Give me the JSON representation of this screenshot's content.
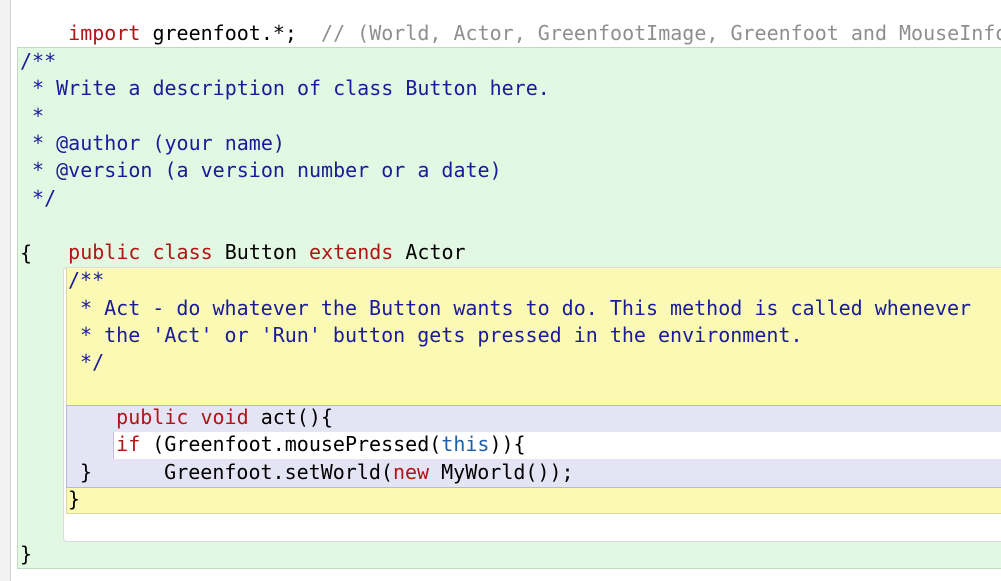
{
  "editor": {
    "import_line": {
      "keyword": "import",
      "statement": " greenfoot.*;",
      "comment": "  // (World, Actor, GreenfootImage, Greenfoot and MouseInfo)"
    },
    "class_doc": {
      "open": "/**",
      "line1": " * Write a description of class Button here.",
      "line2": " *",
      "line3": " * @author (your name)",
      "line4": " * @version (a version number or a date)",
      "close": " */"
    },
    "class_decl": {
      "kw_public": "public",
      "kw_class": "class",
      "name": "Button",
      "kw_extends": "extends",
      "parent": "Actor"
    },
    "class_open_brace": "{",
    "method_doc": {
      "open": "/**",
      "line1": " * Act - do whatever the Button wants to do. This method is called whenever",
      "line2": " * the 'Act' or 'Run' button gets pressed in the environment.",
      "close": " */"
    },
    "method_decl": {
      "kw_public": "public",
      "kw_void": "void",
      "rest": "act(){"
    },
    "if_stmt": {
      "kw_if": "if",
      "cond_start": " (Greenfoot.mousePressed(",
      "kw_this": "this",
      "cond_end": ")){"
    },
    "body_stmt": {
      "call_start": "Greenfoot.setWorld(",
      "kw_new": "new",
      "call_end": " MyWorld());"
    },
    "if_close_brace": "}",
    "method_close_brace": "}",
    "class_close_brace": "}"
  }
}
